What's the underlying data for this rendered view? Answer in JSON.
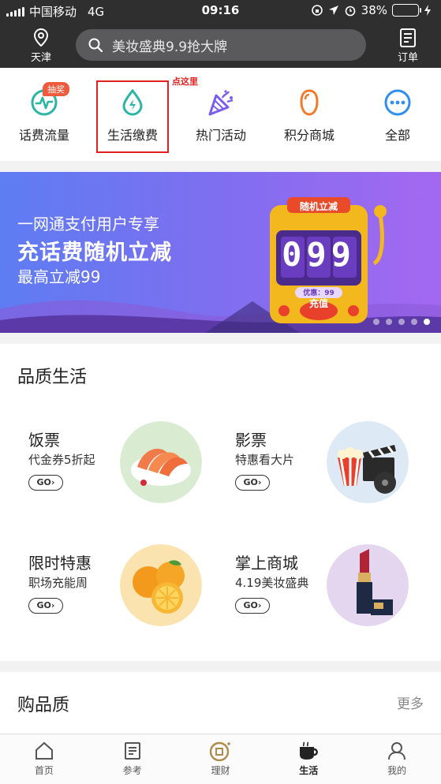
{
  "status": {
    "carrier": "中国移动",
    "network": "4G",
    "time": "09:16",
    "battery": "38%",
    "battery_level": 0.38
  },
  "header": {
    "location": "天津",
    "search_placeholder": "美妆盛典9.9抢大牌",
    "orders": "订单"
  },
  "quick": {
    "items": [
      {
        "label": "话费流量",
        "badge": "抽奖",
        "icon": "pulse-icon",
        "color": "#2bb5a4"
      },
      {
        "label": "生活缴费",
        "icon": "water-drop-icon",
        "color": "#2bb5a4"
      },
      {
        "label": "热门活动",
        "icon": "party-popper-icon",
        "color": "#7a5cf0"
      },
      {
        "label": "积分商城",
        "icon": "gem-icon",
        "color": "#f07a2a"
      },
      {
        "label": "全部",
        "icon": "more-dots-icon",
        "color": "#2f8ef2"
      }
    ],
    "hint": "点这里"
  },
  "banner": {
    "subtitle": "一网通支付用户专享",
    "title": "充话费随机立减",
    "note": "最高立减99",
    "machine_title": "随机立减",
    "digits": "099",
    "coupon": "优惠：99",
    "button": "充值",
    "page_count": 5,
    "active_page": 5
  },
  "life": {
    "title": "品质生活",
    "cards": [
      {
        "name": "饭票",
        "desc": "代金券5折起",
        "go": "GO",
        "icon": "shrimp-platter-icon"
      },
      {
        "name": "影票",
        "desc": "特惠看大片",
        "go": "GO",
        "icon": "cinema-icon"
      },
      {
        "name": "限时特惠",
        "desc": "职场充能周",
        "go": "GO",
        "icon": "orange-icon"
      },
      {
        "name": "掌上商城",
        "desc": "4.19美妆盛典",
        "go": "GO",
        "icon": "lipstick-icon"
      }
    ]
  },
  "buy": {
    "title": "购品质",
    "more": "更多"
  },
  "tabs": [
    {
      "label": "首页",
      "icon": "home-icon"
    },
    {
      "label": "参考",
      "icon": "document-icon"
    },
    {
      "label": "理财",
      "icon": "coin-icon"
    },
    {
      "label": "生活",
      "icon": "coffee-cup-icon",
      "active": true
    },
    {
      "label": "我的",
      "icon": "person-icon"
    }
  ]
}
